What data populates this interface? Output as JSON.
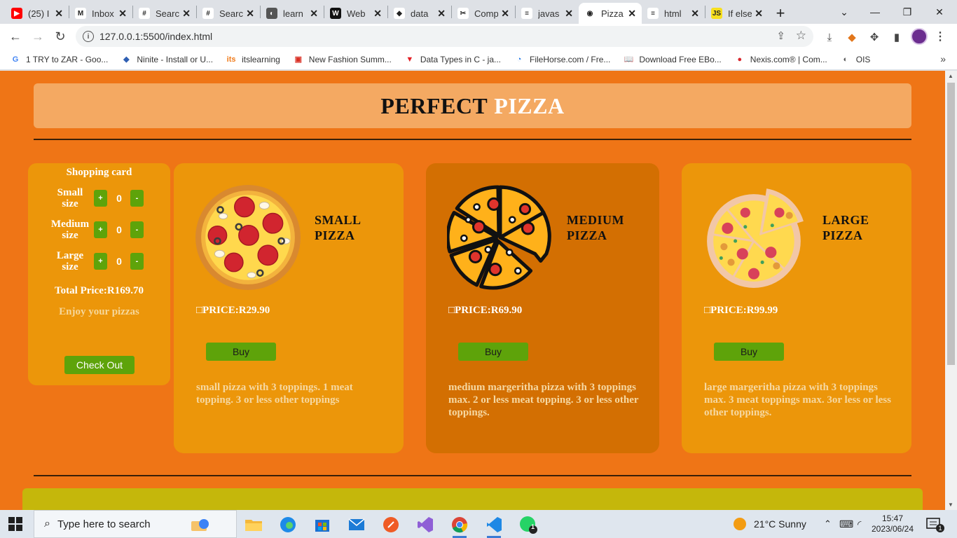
{
  "browser": {
    "tabs": [
      {
        "label": "(25) I",
        "fav_color": "#ff0000",
        "fav_glyph": "▶"
      },
      {
        "label": "Inbox",
        "fav_color": "#ffffff",
        "fav_glyph": "M"
      },
      {
        "label": "Searc",
        "fav_color": "#ffffff",
        "fav_glyph": "#"
      },
      {
        "label": "Searc",
        "fav_color": "#ffffff",
        "fav_glyph": "#"
      },
      {
        "label": "learn",
        "fav_color": "#555555",
        "fav_glyph": "◐"
      },
      {
        "label": "Web",
        "fav_color": "#111111",
        "fav_glyph": "W"
      },
      {
        "label": "data",
        "fav_color": "#ffffff",
        "fav_glyph": "◆"
      },
      {
        "label": "Comp",
        "fav_color": "#ffffff",
        "fav_glyph": "✂"
      },
      {
        "label": "javas",
        "fav_color": "#ffffff",
        "fav_glyph": "≡"
      },
      {
        "label": "Pizza",
        "fav_color": "#ffffff",
        "fav_glyph": "◉",
        "active": true
      },
      {
        "label": "html",
        "fav_color": "#ffffff",
        "fav_glyph": "≡"
      },
      {
        "label": "If else",
        "fav_color": "#f7df1e",
        "fav_glyph": "JS"
      }
    ],
    "url": "127.0.0.1:5500/index.html",
    "bookmarks": [
      {
        "label": "1 TRY to ZAR - Goo...",
        "icon": "G",
        "color": "#4285f4"
      },
      {
        "label": "Ninite - Install or U...",
        "icon": "◆",
        "color": "#2f5fb3"
      },
      {
        "label": "itslearning",
        "icon": "its",
        "color": "#f07b1a"
      },
      {
        "label": "New Fashion Summ...",
        "icon": "▣",
        "color": "#d93025"
      },
      {
        "label": "Data Types in C - ja...",
        "icon": "▼",
        "color": "#e31e24"
      },
      {
        "label": "FileHorse.com / Fre...",
        "icon": "◔",
        "color": "#1a73e8"
      },
      {
        "label": "Download Free EBo...",
        "icon": "📖",
        "color": "#3a5aa8"
      },
      {
        "label": "Nexis.com® | Com...",
        "icon": "●",
        "color": "#d9272e"
      },
      {
        "label": "OIS",
        "icon": "◐",
        "color": "#555555"
      }
    ]
  },
  "page": {
    "hero": {
      "word1": "PERFECT",
      "word2": "PIZZA"
    },
    "cart": {
      "title": "Shopping card",
      "rows": [
        {
          "label": "Small size",
          "plus": "+",
          "qty": "0",
          "minus": "-"
        },
        {
          "label": "Medium size",
          "plus": "+",
          "qty": "0",
          "minus": "-"
        },
        {
          "label": "Large size",
          "plus": "+",
          "qty": "0",
          "minus": "-"
        }
      ],
      "total": "Total Price:R169.70",
      "enjoy": "Enjoy your pizzas",
      "checkout": "Check Out"
    },
    "products": [
      {
        "name_line1": "SMALL",
        "name_line2": "PIZZA",
        "price": "□PRICE:R29.90",
        "buy": "Buy",
        "description": "small pizza with 3 toppings. 1 meat topping. 3 or less other toppings"
      },
      {
        "name_line1": "MEDIUM",
        "name_line2": "PIZZA",
        "price": "□PRICE:R69.90",
        "buy": "Buy",
        "description": "medium margeritha pizza with 3 toppings max. 2 or less meat topping. 3 or less other toppings."
      },
      {
        "name_line1": "LARGE",
        "name_line2": "PIZZA",
        "price": "□PRICE:R99.99",
        "buy": "Buy",
        "description": "large margeritha pizza with 3 toppings max. 3 meat toppings max. 3or less or less other toppings."
      }
    ],
    "colors": {
      "background": "#ef7516",
      "card": "#ec960a",
      "card_alt": "#d36f02",
      "button": "#5ea30a",
      "hero": "#f4a962",
      "footer": "#c5b70b"
    }
  },
  "taskbar": {
    "search_placeholder": "Type here to search",
    "weather": "21°C  Sunny",
    "time": "15:47",
    "date": "2023/06/24",
    "notification_count": "1",
    "whatsapp_badge": "1"
  }
}
